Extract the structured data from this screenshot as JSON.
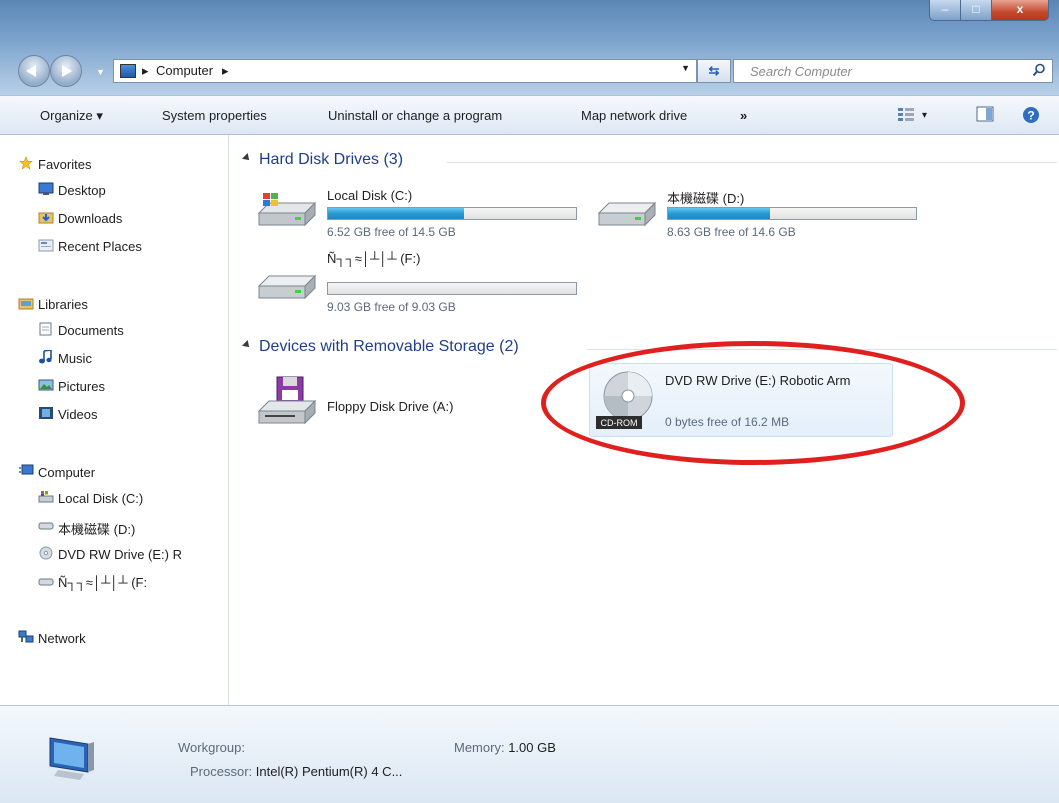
{
  "window": {
    "caption_buttons": {
      "minimize": "–",
      "maximize": "□",
      "close": "x"
    }
  },
  "navbar": {
    "address": {
      "crumbs": [
        "Computer"
      ],
      "separator": "▸"
    },
    "search": {
      "placeholder": "Search Computer"
    }
  },
  "toolbar": {
    "organize": "Organize ▾",
    "system_properties": "System properties",
    "uninstall": "Uninstall or change a program",
    "map_drive": "Map network drive",
    "more": "»",
    "views_arrow": "▾"
  },
  "sidebar": {
    "favorites": {
      "label": "Favorites",
      "items": [
        "Desktop",
        "Downloads",
        "Recent Places"
      ]
    },
    "libraries": {
      "label": "Libraries",
      "items": [
        "Documents",
        "Music",
        "Pictures",
        "Videos"
      ]
    },
    "computer": {
      "label": "Computer",
      "items": [
        "Local Disk (C:)",
        "本機磁碟 (D:)",
        "DVD RW Drive (E:) R",
        "Ñ┐┐≈│┴│┴ (F:"
      ]
    },
    "network": {
      "label": "Network"
    }
  },
  "content": {
    "hard_disks": {
      "header": "Hard Disk Drives (3)",
      "drives": [
        {
          "name": "Local Disk (C:)",
          "free_text": "6.52 GB free of 14.5 GB",
          "used_fraction": 0.55
        },
        {
          "name": "本機磁碟 (D:)",
          "free_text": "8.63 GB free of 14.6 GB",
          "used_fraction": 0.41
        },
        {
          "name": "Ñ┐┐≈│┴│┴ (F:)",
          "free_text": "9.03 GB free of 9.03 GB",
          "used_fraction": 0.0
        }
      ]
    },
    "removable": {
      "header": "Devices with Removable Storage (2)",
      "devices": [
        {
          "name": "Floppy Disk Drive (A:)"
        },
        {
          "name": "DVD RW Drive (E:) Robotic Arm",
          "free_text": "0 bytes free of 16.2 MB",
          "badge": "CD-ROM"
        }
      ]
    },
    "highlight_color": "#e0201e"
  },
  "details": {
    "workgroup_label": "Workgroup:",
    "workgroup_value": "",
    "memory_label": "Memory:",
    "memory_value": "1.00 GB",
    "processor_label": "Processor:",
    "processor_value": "Intel(R) Pentium(R) 4 C..."
  }
}
